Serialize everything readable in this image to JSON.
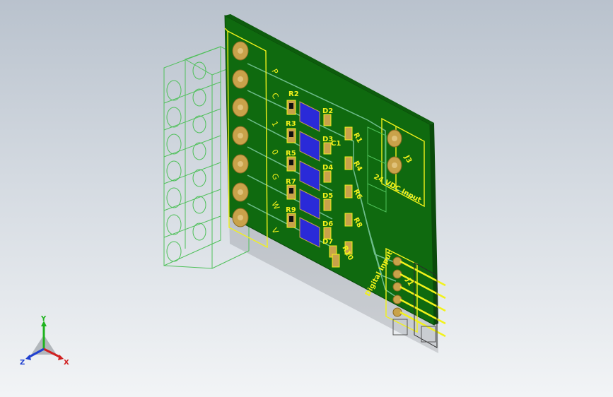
{
  "viewport": {
    "silkscreen_labels": {
      "r2": "R2",
      "r3": "R3",
      "r5": "R5",
      "r7": "R7",
      "r9": "R9",
      "d2": "D2",
      "d3": "D3",
      "d4": "D4",
      "d5": "D5",
      "d6": "D6",
      "d7": "D7",
      "c1": "C1",
      "r1": "R1",
      "r4": "R4",
      "r6": "R6",
      "r8": "R8",
      "r10": "R10",
      "j1": "J1",
      "j3": "J3",
      "power_input": "24 VDC Input",
      "digital_input": "Digital Input"
    },
    "pin_labels": [
      "P",
      "C",
      "1",
      "0",
      "G",
      "W",
      "V"
    ],
    "colors": {
      "board": "#0f6a0f",
      "board_edge": "#0a4a0a",
      "silkscreen": "#f2f21a",
      "pad": "#c9a24a",
      "trace": "#79c79a",
      "wireframe": "#4fc05a",
      "component_blue": "#2a2ad8"
    }
  },
  "triad": {
    "y_label": "Y",
    "x_label": "X",
    "z_label": "Z",
    "y_color": "#1fb31f",
    "x_color": "#d02020",
    "z_color": "#2040d0"
  }
}
